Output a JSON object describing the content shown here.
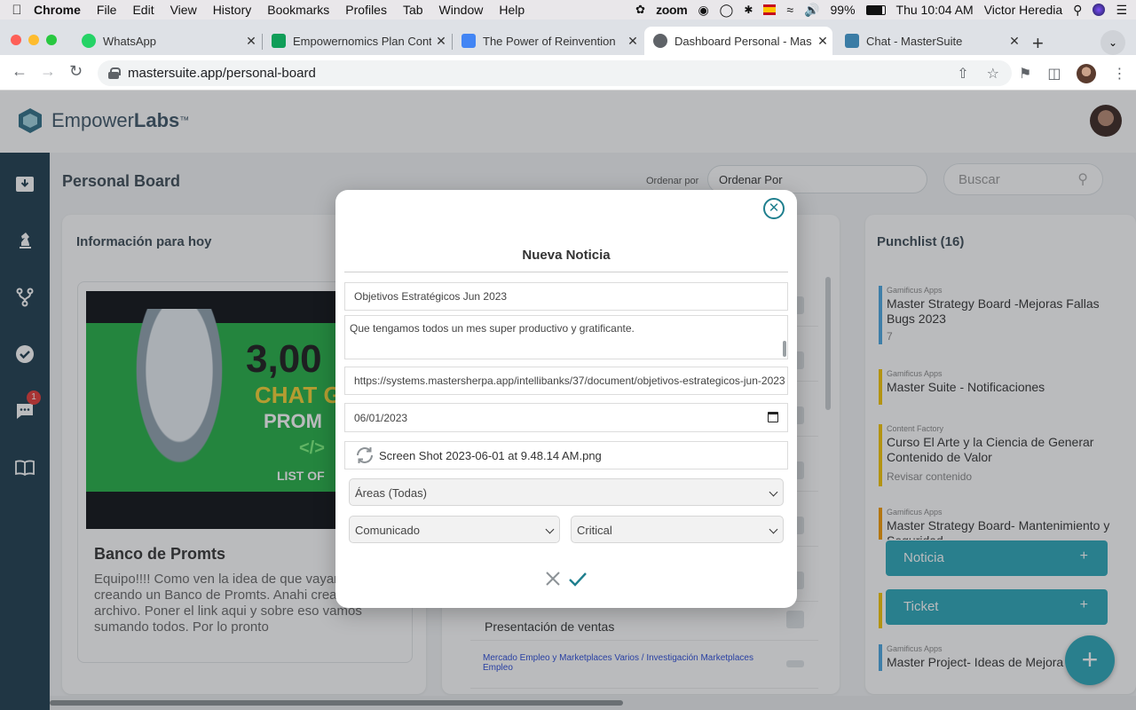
{
  "menubar": {
    "app": "Chrome",
    "items": [
      "File",
      "Edit",
      "View",
      "History",
      "Bookmarks",
      "Profiles",
      "Tab",
      "Window",
      "Help"
    ],
    "zoom_label": "zoom",
    "battery": "99%",
    "clock": "Thu 10:04 AM",
    "user": "Victor Heredia"
  },
  "tabs": [
    {
      "title": "WhatsApp",
      "favicon_color": "#25d366"
    },
    {
      "title": "Empowernomics Plan Conte",
      "favicon_color": "#0f9d58"
    },
    {
      "title": "The Power of Reinvention",
      "favicon_color": "#4285f4"
    },
    {
      "title": "Dashboard Personal - Mas",
      "favicon_color": "#5f6368"
    },
    {
      "title": "Chat - MasterSuite",
      "favicon_color": "#3a7ca5"
    }
  ],
  "address_bar": {
    "url": "mastersuite.app/personal-board"
  },
  "app": {
    "logo_light": "Empower",
    "logo_bold": "Labs",
    "logo_tm": "™",
    "board_title": "Personal Board",
    "order_label": "Ordenar por",
    "order_value": "Ordenar Por",
    "search_placeholder": "Buscar",
    "chat_badge": "1",
    "info_panel": {
      "title": "Información para hoy",
      "card_title": "Banco de Promts",
      "card_body": "Equipo!!!! Como ven la idea de que vayamos creando un Banco de Promts. Anahi creando un archivo. Poner el link aqui y sobre eso vamos sumando todos. Por lo pronto",
      "image_text": {
        "big": "3,00",
        "chat": "CHAT G",
        "prom": "PROM",
        "code": "</>",
        "list": "LIST OF"
      }
    },
    "mid_rows": [
      {
        "link": "",
        "text": ""
      },
      {
        "link": "",
        "text": ""
      },
      {
        "link": "",
        "text": ""
      },
      {
        "link": "",
        "text": ""
      },
      {
        "link": "",
        "text": ""
      },
      {
        "link": "",
        "text": ""
      },
      {
        "link": "",
        "text": "Presentación de ventas"
      },
      {
        "link": "Mercado Empleo y Marketplaces Varios / Investigación Marketplaces Empleo",
        "text": ""
      }
    ],
    "punchlist": {
      "title": "Punchlist (16)",
      "items": [
        {
          "category": "Gamificus Apps",
          "name": "Master Strategy Board -Mejoras Fallas Bugs 2023",
          "sub": "7",
          "color": "#49a6e0"
        },
        {
          "category": "Gamificus Apps",
          "name": "Master Suite - Notificaciones",
          "sub": "",
          "color": "#f5c400"
        },
        {
          "category": "Content Factory",
          "name": "Curso El Arte y la Ciencia de Generar Contenido de Valor",
          "sub": "Revisar contenido",
          "color": "#f5c400"
        },
        {
          "category": "Gamificus Apps",
          "name": "Master Strategy Board- Mantenimiento y Seguridad",
          "sub": "",
          "color": "#f59a00"
        },
        {
          "category": "",
          "name": "",
          "sub": "",
          "color": "#f5c400"
        },
        {
          "category": "Gamificus Apps",
          "name": "Master Project- Ideas de Mejora",
          "sub": "",
          "color": "#49a6e0"
        }
      ],
      "btn_noticia": "Noticia",
      "btn_ticket": "Ticket",
      "plus": "+"
    }
  },
  "modal": {
    "title": "Nueva Noticia",
    "title_value": "Objetivos Estratégicos Jun 2023",
    "description_value": "Que tengamos todos un mes super productivo y gratificante.",
    "url_value": "https://systems.mastersherpa.app/intellibanks/37/document/objetivos-estrategicos-jun-2023",
    "date_value": "06/01/2023",
    "file_name": "Screen Shot 2023-06-01 at 9.48.14 AM.png",
    "areas_value": "Áreas (Todas)",
    "type_value": "Comunicado",
    "priority_value": "Critical",
    "accent_color": "#1f7f8e"
  }
}
